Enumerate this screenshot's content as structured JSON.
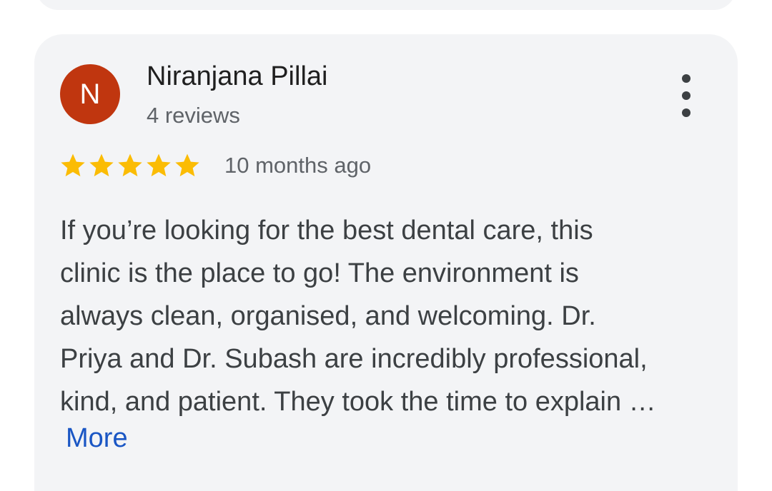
{
  "review": {
    "avatar_initial": "N",
    "author_name": "Niranjana Pillai",
    "author_reviews": "4 reviews",
    "rating": 5,
    "rating_max": 5,
    "time_ago": "10 months ago",
    "text_lines": [
      "If you’re looking for the best dental care, this",
      "clinic is the place to go! The environment is",
      "always clean, organised, and welcoming. Dr.",
      "Priya and Dr. Subash are incredibly professional,",
      "kind, and patient. They took the time to explain …"
    ],
    "more_label": "More"
  },
  "colors": {
    "avatar_bg": "#c0360f",
    "star": "#fbbc04",
    "link": "#1a56c4",
    "card_bg": "#f3f4f6"
  },
  "icons": {
    "menu": "more-vert-icon",
    "star": "star-icon"
  }
}
